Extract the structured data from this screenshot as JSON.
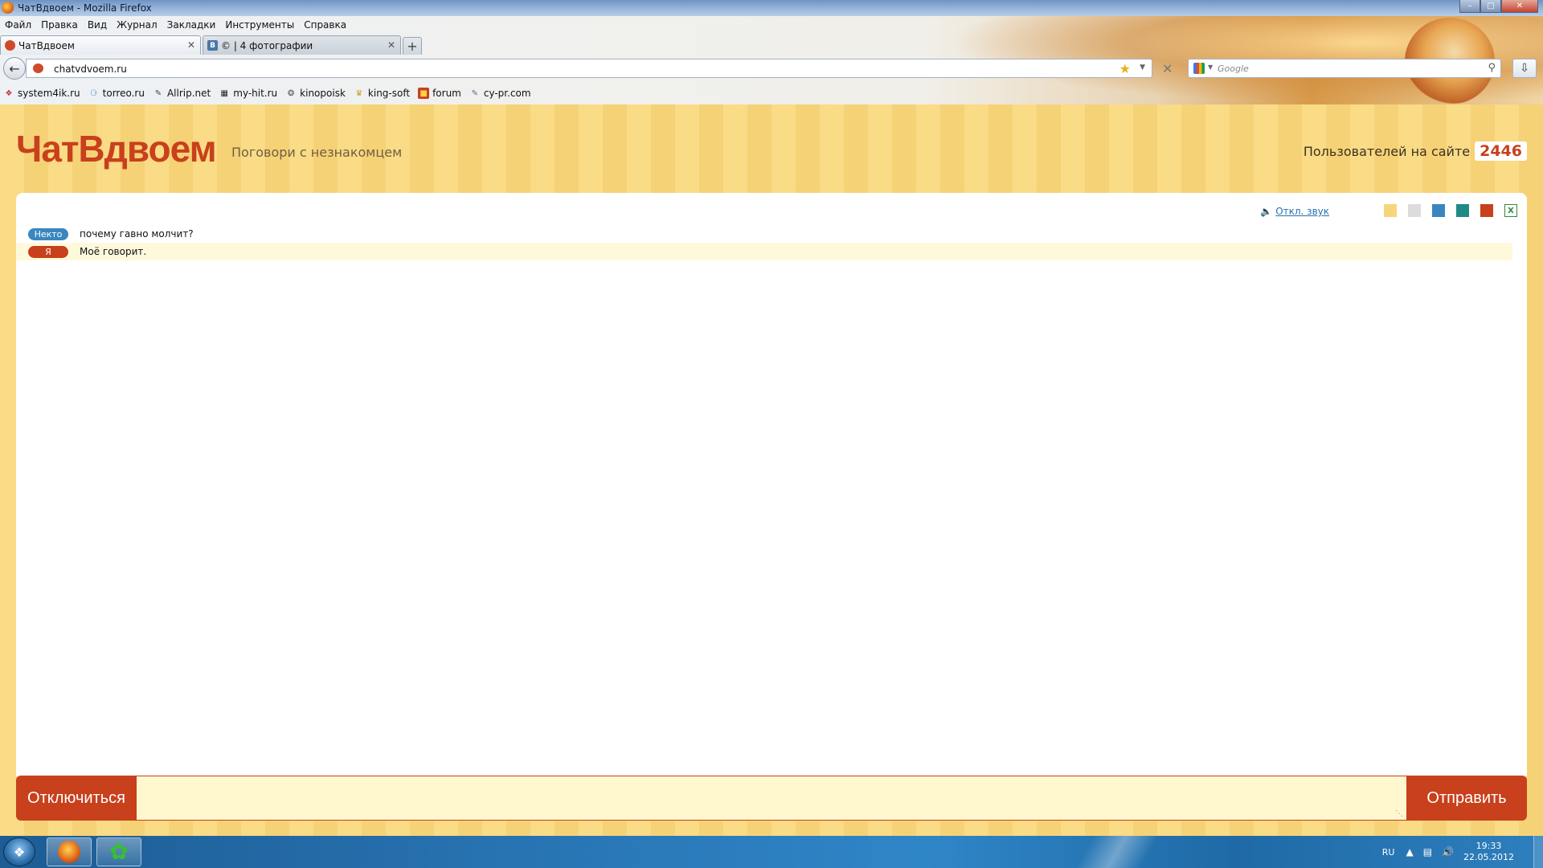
{
  "window": {
    "title": "ЧатВдвоем - Mozilla Firefox"
  },
  "menu": [
    "Файл",
    "Правка",
    "Вид",
    "Журнал",
    "Закладки",
    "Инструменты",
    "Справка"
  ],
  "tabs": [
    {
      "label": "ЧатВдвоем",
      "active": true
    },
    {
      "label": "© | 4 фотографии",
      "active": false,
      "icon_text": "В"
    }
  ],
  "navbar": {
    "url": "chatvdvoem.ru",
    "search_placeholder": "Google"
  },
  "bookmarks": [
    {
      "label": "system4ik.ru"
    },
    {
      "label": "torreo.ru"
    },
    {
      "label": "Allrip.net"
    },
    {
      "label": "my-hit.ru"
    },
    {
      "label": "kinopoisk"
    },
    {
      "label": "king-soft"
    },
    {
      "label": "forum"
    },
    {
      "label": "cy-pr.com"
    }
  ],
  "site": {
    "logo": "ЧатВдвоем",
    "tagline": "Поговори с незнакомцем",
    "users_label": "Пользователей на сайте",
    "users_count": "2446",
    "sound_toggle": "Откл. звук",
    "theme_colors": [
      "#f7d57a",
      "#dcdcdc",
      "#3a86c0",
      "#1f8a86",
      "#c8401c"
    ],
    "excel_icon_text": "X"
  },
  "messages": [
    {
      "author": "Некто",
      "text": "почему гавно молчит?",
      "type": "stranger"
    },
    {
      "author": "Я",
      "text": "Моё говорит.",
      "type": "self"
    }
  ],
  "input": {
    "disconnect_label": "Отключиться",
    "send_label": "Отправить",
    "value": ""
  },
  "taskbar": {
    "lang": "RU",
    "time": "19:33",
    "date": "22.05.2012"
  },
  "colors": {
    "accent": "#c8401c",
    "stranger": "#3a86c0",
    "page_bg": "#f7d57a"
  }
}
